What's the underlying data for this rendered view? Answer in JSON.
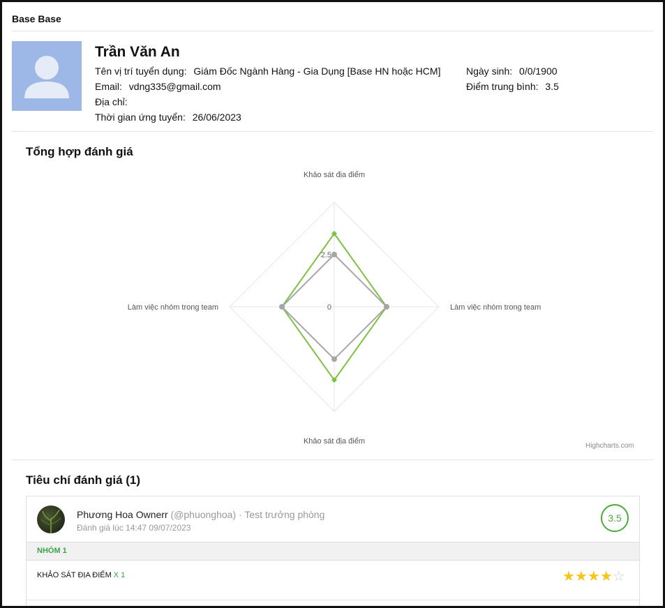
{
  "header": {
    "title": "Base Base"
  },
  "candidate": {
    "name": "Trần Văn An",
    "position_label": "Tên vị trí tuyển dụng:",
    "position_value": "Giám Đốc Ngành Hàng - Gia Dụng [Base HN hoặc HCM]",
    "email_label": "Email:",
    "email_value": "vdng335@gmail.com",
    "address_label": "Địa chỉ:",
    "address_value": "",
    "applied_label": "Thời gian ứng tuyển:",
    "applied_value": "26/06/2023",
    "dob_label": "Ngày sinh:",
    "dob_value": "0/0/1900",
    "avg_label": "Điểm trung bình:",
    "avg_value": "3.5"
  },
  "summary": {
    "title": "Tổng hợp đánh giá",
    "credits": "Highcharts.com"
  },
  "chart_data": {
    "type": "radar",
    "categories": [
      "Khảo sát địa điểm",
      "Làm việc nhóm trong team",
      "Khảo sát địa điểm",
      "Làm việc nhóm trong team"
    ],
    "tick_labels": [
      "0",
      "2.5"
    ],
    "ylim": [
      0,
      5
    ],
    "series": [
      {
        "values": [
          3.5,
          2.5,
          3.5,
          2.5
        ],
        "color": "#7cc243"
      },
      {
        "values": [
          2.5,
          2.5,
          2.5,
          2.5
        ],
        "color": "#a6a6a6"
      }
    ]
  },
  "criteria": {
    "title": "Tiêu chí đánh giá (1)",
    "review": {
      "reviewer": "Phương Hoa Ownerr",
      "handle": "(@phuonghoa)",
      "role": "· Test trưởng phòng",
      "time": "Đánh giá lúc 14:47 09/07/2023",
      "score": "3.5",
      "group": "NHÓM 1",
      "criterion": "KHẢO SÁT ĐỊA ĐIỂM",
      "multiplier": "X 1",
      "rating": 4,
      "rating_max": 5
    }
  }
}
